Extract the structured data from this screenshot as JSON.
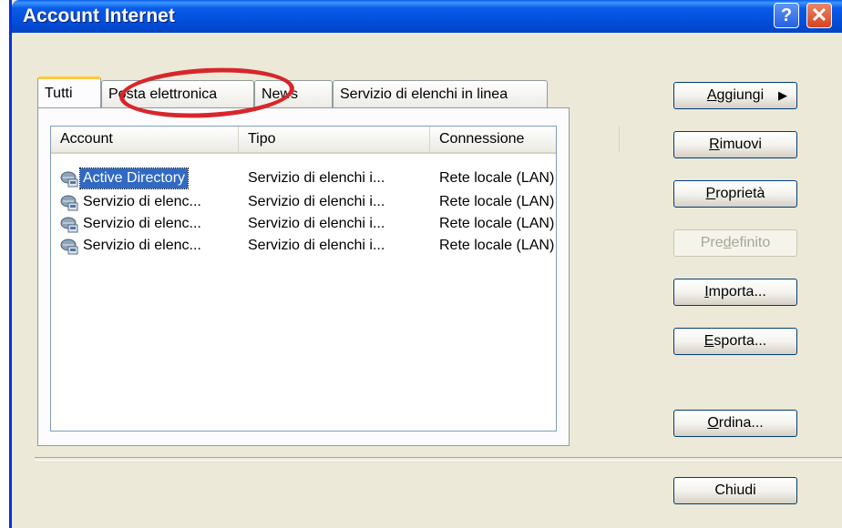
{
  "window": {
    "title": "Account Internet",
    "help_label": "?",
    "close_label": "✕"
  },
  "tabs": [
    {
      "label": "Tutti",
      "active": true
    },
    {
      "label": "Posta elettronica",
      "active": false
    },
    {
      "label": "News",
      "active": false
    },
    {
      "label": "Servizio di elenchi in linea",
      "active": false
    }
  ],
  "list": {
    "columns": [
      "Account",
      "Tipo",
      "Connessione"
    ],
    "rows": [
      {
        "account": "Active Directory",
        "tipo": "Servizio di elenchi i...",
        "connessione": "Rete locale (LAN)",
        "selected": true,
        "icon": "directory-service-icon"
      },
      {
        "account": "Servizio di elenc...",
        "tipo": "Servizio di elenchi i...",
        "connessione": "Rete locale (LAN)",
        "selected": false,
        "icon": "directory-service-icon"
      },
      {
        "account": "Servizio di elenc...",
        "tipo": "Servizio di elenchi i...",
        "connessione": "Rete locale (LAN)",
        "selected": false,
        "icon": "directory-service-icon"
      },
      {
        "account": "Servizio di elenc...",
        "tipo": "Servizio di elenchi i...",
        "connessione": "Rete locale (LAN)",
        "selected": false,
        "icon": "directory-service-icon"
      }
    ]
  },
  "buttons": {
    "aggiungi": {
      "pre": "",
      "key": "A",
      "post": "ggiungi",
      "arrow": "▶"
    },
    "rimuovi": {
      "pre": "",
      "key": "R",
      "post": "imuovi"
    },
    "proprieta": {
      "pre": "",
      "key": "P",
      "post": "roprietà"
    },
    "predefinito": {
      "pre": "Pre",
      "key": "d",
      "post": "efinito",
      "disabled": true
    },
    "importa": {
      "pre": "",
      "key": "I",
      "post": "mporta..."
    },
    "esporta": {
      "pre": "",
      "key": "E",
      "post": "sporta..."
    },
    "ordina": {
      "pre": "",
      "key": "O",
      "post": "rdina..."
    },
    "chiudi": {
      "pre": "",
      "key": "",
      "post": "Chiudi"
    }
  },
  "colors": {
    "titlebar": "#0148CF",
    "selection": "#316AC5",
    "highlight_circle": "#D8262B",
    "dialog_bg": "#ECE9D8"
  }
}
